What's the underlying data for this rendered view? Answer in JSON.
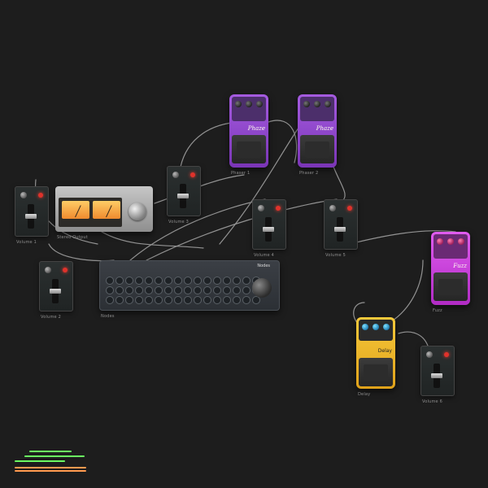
{
  "labels": {
    "fader_left_top": "Volume 1",
    "fader_left_bottom": "Volume 2",
    "vu_meter": "Stereo Output",
    "fader_mid": "Volume 3",
    "pedal_phaser_1": "Phaser 1",
    "pedal_phaser_2": "Phaser 2",
    "fader_mid_right_1": "Volume 4",
    "fader_mid_right_2": "Volume 5",
    "sequencer": "Nodes",
    "pedal_fuzz": "Fuzz",
    "pedal_delay": "Delay",
    "fader_bottom_right": "Volume 6"
  },
  "pedals": {
    "phaser_name": "Phaze",
    "fuzz_name": "Fuzz",
    "delay_name": "Delay"
  },
  "sequencer": {
    "title": "Nodes"
  },
  "vu": {
    "brand": "",
    "caption": ""
  },
  "colors": {
    "background": "#1d1d1d",
    "wire": "#9a9a9a",
    "accent_purple": "#a55be0",
    "accent_magenta": "#e05cf0",
    "accent_yellow": "#f6c93b",
    "accent_red_led": "#e0322b",
    "mini_green": "#6cff62",
    "mini_orange": "#ff9a4f"
  }
}
